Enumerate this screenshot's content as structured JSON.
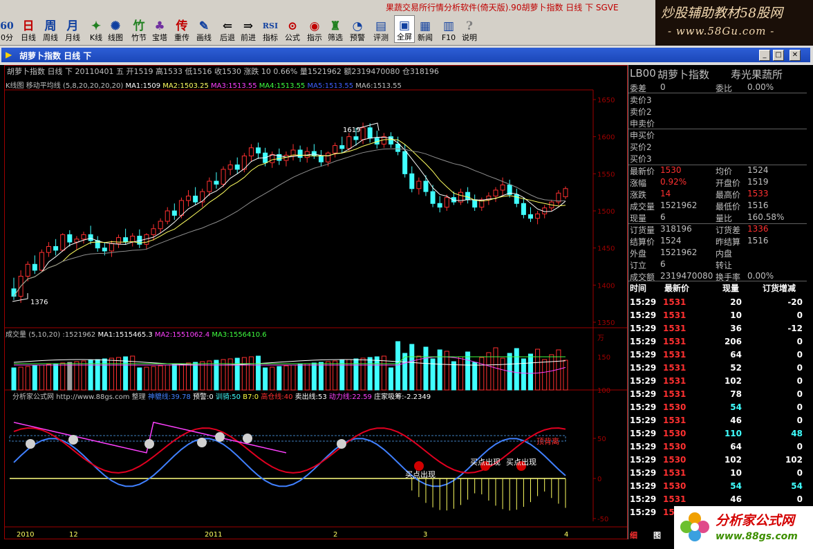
{
  "app_title": "果蔬交易所行情分析软件(倚天版).90胡萝卜指数  日线  下  SGVE",
  "watermark_top": {
    "line1": "炒股辅助教材58股网",
    "line2": "- www.58Gu.com -"
  },
  "toolbar": [
    {
      "label": "0分",
      "icon": "60"
    },
    {
      "label": "日线",
      "icon": "日",
      "selected": false
    },
    {
      "label": "周线",
      "icon": "周"
    },
    {
      "label": "月线",
      "icon": "月"
    },
    {
      "label": "K线",
      "icon": "✦"
    },
    {
      "label": "线图",
      "icon": "✺"
    },
    {
      "label": "竹节",
      "icon": "竹"
    },
    {
      "label": "宝塔",
      "icon": "♣"
    },
    {
      "label": "重传",
      "icon": "传"
    },
    {
      "label": "画线",
      "icon": "✎"
    },
    {
      "label": "后退",
      "icon": "⇐"
    },
    {
      "label": "前进",
      "icon": "⇒"
    },
    {
      "label": "指标",
      "icon": "RSI"
    },
    {
      "label": "公式",
      "icon": "⊙"
    },
    {
      "label": "指示",
      "icon": "◉"
    },
    {
      "label": "筛选",
      "icon": "♜"
    },
    {
      "label": "预警",
      "icon": "◔"
    },
    {
      "label": "评测",
      "icon": "▤"
    },
    {
      "label": "全屏",
      "icon": "▣",
      "selected": true
    },
    {
      "label": "新闻",
      "icon": "▦"
    },
    {
      "label": "F10",
      "icon": "▥"
    },
    {
      "label": "说明",
      "icon": "?"
    }
  ],
  "window": {
    "caption": "胡萝卜指数  日线  下"
  },
  "header": {
    "info": "胡萝卜指数  日线  下  20110401  五  开1519 高1533 低1516 收1530 涨跌  10 0.66% 量1521962 额2319470080 仓318196",
    "ma_line": {
      "label": "K线图",
      "indicator": "移动平均线",
      "params": "(5,8,20,20,20,20)",
      "ma1": "MA1:1509",
      "ma2": "MA2:1503.25",
      "ma3": "MA3:1513.55",
      "ma4": "MA4:1513.55",
      "ma5": "MA5:1513.55",
      "ma6": "MA6:1513.55"
    }
  },
  "vol_header": {
    "label": "成交量",
    "params": "(5,10,20)",
    "value": ":1521962",
    "ma1": "MA1:1515465.3",
    "ma2": "MA2:1551062.4",
    "ma3": "MA3:1556410.6"
  },
  "ind_header": {
    "name": "分析家公式网",
    "url": "http://www.88gs.com",
    "tidy": "整理",
    "s1": "神貔线:39.78",
    "s2": "预警:0",
    "s3": "训骑:50",
    "s4": "B7:0",
    "s5": "高仓线:40",
    "s6": "卖出线:53",
    "s7": "动力线:22.59",
    "s8": "庄家吸筹:-2.2349"
  },
  "price_axis": [
    "1650",
    "1600",
    "1550",
    "1500",
    "1450",
    "1400",
    "1350"
  ],
  "vol_axis": [
    "万",
    "150",
    "100"
  ],
  "ind_axis": [
    "50",
    "0",
    "-50"
  ],
  "x_labels": [
    "2010",
    "12",
    "2011",
    "2",
    "3",
    "4"
  ],
  "annotations": {
    "high": "1619",
    "low": "1376",
    "buy1": "买点出现",
    "buy2": "买点出现",
    "buy3": "买点出现",
    "warn": "顶背离"
  },
  "chart_data": {
    "type": "candlestick",
    "series": [
      {
        "name": "K线",
        "ohlc": [
          [
            1395,
            1410,
            1380,
            1385
          ],
          [
            1385,
            1420,
            1376,
            1412
          ],
          [
            1412,
            1432,
            1405,
            1428
          ],
          [
            1428,
            1440,
            1415,
            1420
          ],
          [
            1420,
            1448,
            1418,
            1444
          ],
          [
            1444,
            1458,
            1438,
            1452
          ],
          [
            1452,
            1462,
            1440,
            1447
          ],
          [
            1447,
            1470,
            1445,
            1468
          ],
          [
            1468,
            1474,
            1452,
            1458
          ],
          [
            1458,
            1466,
            1448,
            1462
          ],
          [
            1462,
            1472,
            1456,
            1468
          ],
          [
            1468,
            1480,
            1455,
            1460
          ],
          [
            1460,
            1466,
            1445,
            1450
          ],
          [
            1450,
            1458,
            1440,
            1446
          ],
          [
            1446,
            1460,
            1438,
            1456
          ],
          [
            1456,
            1468,
            1450,
            1464
          ],
          [
            1464,
            1476,
            1455,
            1458
          ],
          [
            1458,
            1470,
            1452,
            1466
          ],
          [
            1466,
            1475,
            1450,
            1455
          ],
          [
            1455,
            1470,
            1448,
            1468
          ],
          [
            1468,
            1482,
            1460,
            1476
          ],
          [
            1476,
            1490,
            1470,
            1486
          ],
          [
            1486,
            1505,
            1482,
            1500
          ],
          [
            1500,
            1510,
            1488,
            1494
          ],
          [
            1494,
            1518,
            1490,
            1514
          ],
          [
            1514,
            1528,
            1506,
            1520
          ],
          [
            1520,
            1532,
            1508,
            1512
          ],
          [
            1512,
            1530,
            1505,
            1526
          ],
          [
            1526,
            1545,
            1520,
            1540
          ],
          [
            1540,
            1552,
            1530,
            1536
          ],
          [
            1536,
            1560,
            1532,
            1556
          ],
          [
            1556,
            1568,
            1548,
            1562
          ],
          [
            1562,
            1572,
            1550,
            1556
          ],
          [
            1556,
            1578,
            1552,
            1574
          ],
          [
            1574,
            1590,
            1566,
            1585
          ],
          [
            1585,
            1592,
            1570,
            1578
          ],
          [
            1578,
            1585,
            1560,
            1565
          ],
          [
            1565,
            1580,
            1558,
            1576
          ],
          [
            1576,
            1584,
            1562,
            1568
          ],
          [
            1568,
            1580,
            1560,
            1575
          ],
          [
            1575,
            1590,
            1568,
            1582
          ],
          [
            1582,
            1588,
            1566,
            1572
          ],
          [
            1572,
            1586,
            1565,
            1580
          ],
          [
            1580,
            1590,
            1570,
            1574
          ],
          [
            1574,
            1582,
            1560,
            1566
          ],
          [
            1566,
            1580,
            1560,
            1578
          ],
          [
            1578,
            1592,
            1572,
            1588
          ],
          [
            1588,
            1600,
            1578,
            1584
          ],
          [
            1584,
            1605,
            1580,
            1600
          ],
          [
            1600,
            1612,
            1588,
            1596
          ],
          [
            1596,
            1619,
            1590,
            1612
          ],
          [
            1612,
            1618,
            1592,
            1598
          ],
          [
            1598,
            1608,
            1584,
            1590
          ],
          [
            1590,
            1605,
            1585,
            1600
          ],
          [
            1600,
            1606,
            1585,
            1590
          ],
          [
            1590,
            1600,
            1575,
            1580
          ],
          [
            1580,
            1590,
            1545,
            1550
          ],
          [
            1550,
            1560,
            1525,
            1530
          ],
          [
            1530,
            1545,
            1522,
            1540
          ],
          [
            1540,
            1548,
            1520,
            1526
          ],
          [
            1526,
            1535,
            1505,
            1510
          ],
          [
            1510,
            1520,
            1498,
            1505
          ],
          [
            1505,
            1522,
            1500,
            1518
          ],
          [
            1518,
            1526,
            1508,
            1512
          ],
          [
            1512,
            1530,
            1508,
            1525
          ],
          [
            1525,
            1532,
            1510,
            1515
          ],
          [
            1515,
            1522,
            1500,
            1505
          ],
          [
            1505,
            1518,
            1500,
            1515
          ],
          [
            1515,
            1525,
            1508,
            1520
          ],
          [
            1520,
            1532,
            1512,
            1528
          ],
          [
            1528,
            1545,
            1520,
            1535
          ],
          [
            1535,
            1542,
            1518,
            1522
          ],
          [
            1522,
            1530,
            1505,
            1510
          ],
          [
            1510,
            1518,
            1490,
            1495
          ],
          [
            1495,
            1505,
            1485,
            1490
          ],
          [
            1490,
            1500,
            1482,
            1496
          ],
          [
            1496,
            1508,
            1490,
            1504
          ],
          [
            1504,
            1515,
            1500,
            1512
          ],
          [
            1512,
            1528,
            1508,
            1524
          ],
          [
            1519,
            1533,
            1516,
            1530
          ]
        ]
      }
    ]
  },
  "sidebar": {
    "code": "LB00",
    "name": "胡萝卜指数",
    "exchange": "寿光果蔬所",
    "rows": [
      {
        "l": "委差",
        "v": "0",
        "l2": "委比",
        "v2": "0.00%"
      },
      {
        "l": "卖价3"
      },
      {
        "l": "卖价2"
      },
      {
        "l": "申卖价"
      },
      {
        "l": "申买价"
      },
      {
        "l": "买价2"
      },
      {
        "l": "买价3"
      },
      {
        "l": "最新价",
        "v": "1530",
        "l2": "均价",
        "v2": "1524"
      },
      {
        "l": "涨幅",
        "v": "0.92%",
        "l2": "开盘价",
        "v2": "1519"
      },
      {
        "l": "涨跌",
        "v": "14",
        "l2": "最高价",
        "v2": "1533"
      },
      {
        "l": "成交量",
        "v": "1521962",
        "l2": "最低价",
        "v2": "1516"
      },
      {
        "l": "现量",
        "v": "6",
        "l2": "量比",
        "v2": "160.58%"
      },
      {
        "l": "订货量",
        "v": "318196",
        "l2": "订货差",
        "v2": "1336"
      },
      {
        "l": "结算价",
        "v": "1524",
        "l2": "昨结算",
        "v2": "1516"
      },
      {
        "l": "外盘",
        "v": "1521962",
        "l2": "内盘",
        "v2": ""
      },
      {
        "l": "订立",
        "v": "6",
        "l2": "转让",
        "v2": ""
      },
      {
        "l": "成交额",
        "v": "2319470080",
        "l2": "换手率",
        "v2": "0.00%"
      }
    ],
    "trade_head": {
      "time": "时间",
      "price": "最新价",
      "vol": "现量",
      "oi": "订货增减"
    },
    "trades": [
      {
        "t": "15:29",
        "p": "1531",
        "v": "20",
        "o": "-20"
      },
      {
        "t": "15:29",
        "p": "1531",
        "v": "10",
        "o": "0"
      },
      {
        "t": "15:29",
        "p": "1531",
        "v": "36",
        "o": "-12"
      },
      {
        "t": "15:29",
        "p": "1531",
        "v": "206",
        "o": "0"
      },
      {
        "t": "15:29",
        "p": "1531",
        "v": "64",
        "o": "0"
      },
      {
        "t": "15:29",
        "p": "1531",
        "v": "52",
        "o": "0"
      },
      {
        "t": "15:29",
        "p": "1531",
        "v": "102",
        "o": "0"
      },
      {
        "t": "15:29",
        "p": "1531",
        "v": "78",
        "o": "0"
      },
      {
        "t": "15:29",
        "p": "1530",
        "v": "54",
        "o": "0"
      },
      {
        "t": "15:29",
        "p": "1531",
        "v": "46",
        "o": "0"
      },
      {
        "t": "15:29",
        "p": "1530",
        "v": "110",
        "o": "48"
      },
      {
        "t": "15:29",
        "p": "1530",
        "v": "64",
        "o": "0"
      },
      {
        "t": "15:29",
        "p": "1530",
        "v": "102",
        "o": "102"
      },
      {
        "t": "15:29",
        "p": "1531",
        "v": "10",
        "o": "0"
      },
      {
        "t": "15:29",
        "p": "1530",
        "v": "54",
        "o": "54"
      },
      {
        "t": "15:29",
        "p": "1531",
        "v": "46",
        "o": "0"
      },
      {
        "t": "15:29",
        "p": "15",
        "v": "",
        "o": ""
      }
    ],
    "tabs": [
      "细",
      "图"
    ]
  },
  "watermark_bottom": {
    "line1": "分析家公式网",
    "line2": "www.88gs.com"
  }
}
